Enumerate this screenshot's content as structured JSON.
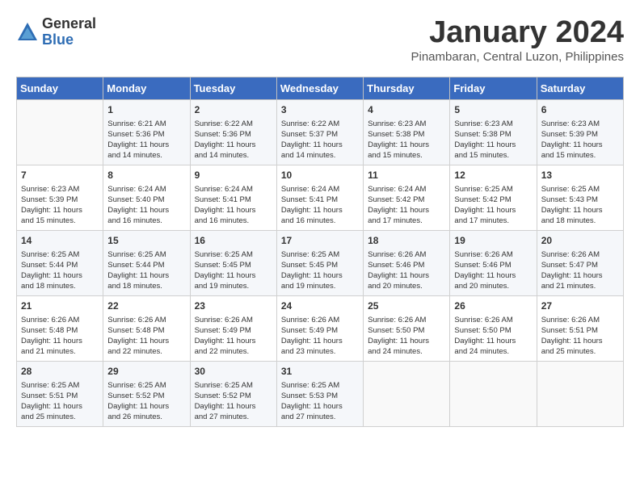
{
  "logo": {
    "general": "General",
    "blue": "Blue"
  },
  "header": {
    "month": "January 2024",
    "location": "Pinambaran, Central Luzon, Philippines"
  },
  "weekdays": [
    "Sunday",
    "Monday",
    "Tuesday",
    "Wednesday",
    "Thursday",
    "Friday",
    "Saturday"
  ],
  "weeks": [
    [
      {
        "day": "",
        "info": ""
      },
      {
        "day": "1",
        "info": "Sunrise: 6:21 AM\nSunset: 5:36 PM\nDaylight: 11 hours\nand 14 minutes."
      },
      {
        "day": "2",
        "info": "Sunrise: 6:22 AM\nSunset: 5:36 PM\nDaylight: 11 hours\nand 14 minutes."
      },
      {
        "day": "3",
        "info": "Sunrise: 6:22 AM\nSunset: 5:37 PM\nDaylight: 11 hours\nand 14 minutes."
      },
      {
        "day": "4",
        "info": "Sunrise: 6:23 AM\nSunset: 5:38 PM\nDaylight: 11 hours\nand 15 minutes."
      },
      {
        "day": "5",
        "info": "Sunrise: 6:23 AM\nSunset: 5:38 PM\nDaylight: 11 hours\nand 15 minutes."
      },
      {
        "day": "6",
        "info": "Sunrise: 6:23 AM\nSunset: 5:39 PM\nDaylight: 11 hours\nand 15 minutes."
      }
    ],
    [
      {
        "day": "7",
        "info": "Sunrise: 6:23 AM\nSunset: 5:39 PM\nDaylight: 11 hours\nand 15 minutes."
      },
      {
        "day": "8",
        "info": "Sunrise: 6:24 AM\nSunset: 5:40 PM\nDaylight: 11 hours\nand 16 minutes."
      },
      {
        "day": "9",
        "info": "Sunrise: 6:24 AM\nSunset: 5:41 PM\nDaylight: 11 hours\nand 16 minutes."
      },
      {
        "day": "10",
        "info": "Sunrise: 6:24 AM\nSunset: 5:41 PM\nDaylight: 11 hours\nand 16 minutes."
      },
      {
        "day": "11",
        "info": "Sunrise: 6:24 AM\nSunset: 5:42 PM\nDaylight: 11 hours\nand 17 minutes."
      },
      {
        "day": "12",
        "info": "Sunrise: 6:25 AM\nSunset: 5:42 PM\nDaylight: 11 hours\nand 17 minutes."
      },
      {
        "day": "13",
        "info": "Sunrise: 6:25 AM\nSunset: 5:43 PM\nDaylight: 11 hours\nand 18 minutes."
      }
    ],
    [
      {
        "day": "14",
        "info": "Sunrise: 6:25 AM\nSunset: 5:44 PM\nDaylight: 11 hours\nand 18 minutes."
      },
      {
        "day": "15",
        "info": "Sunrise: 6:25 AM\nSunset: 5:44 PM\nDaylight: 11 hours\nand 18 minutes."
      },
      {
        "day": "16",
        "info": "Sunrise: 6:25 AM\nSunset: 5:45 PM\nDaylight: 11 hours\nand 19 minutes."
      },
      {
        "day": "17",
        "info": "Sunrise: 6:25 AM\nSunset: 5:45 PM\nDaylight: 11 hours\nand 19 minutes."
      },
      {
        "day": "18",
        "info": "Sunrise: 6:26 AM\nSunset: 5:46 PM\nDaylight: 11 hours\nand 20 minutes."
      },
      {
        "day": "19",
        "info": "Sunrise: 6:26 AM\nSunset: 5:46 PM\nDaylight: 11 hours\nand 20 minutes."
      },
      {
        "day": "20",
        "info": "Sunrise: 6:26 AM\nSunset: 5:47 PM\nDaylight: 11 hours\nand 21 minutes."
      }
    ],
    [
      {
        "day": "21",
        "info": "Sunrise: 6:26 AM\nSunset: 5:48 PM\nDaylight: 11 hours\nand 21 minutes."
      },
      {
        "day": "22",
        "info": "Sunrise: 6:26 AM\nSunset: 5:48 PM\nDaylight: 11 hours\nand 22 minutes."
      },
      {
        "day": "23",
        "info": "Sunrise: 6:26 AM\nSunset: 5:49 PM\nDaylight: 11 hours\nand 22 minutes."
      },
      {
        "day": "24",
        "info": "Sunrise: 6:26 AM\nSunset: 5:49 PM\nDaylight: 11 hours\nand 23 minutes."
      },
      {
        "day": "25",
        "info": "Sunrise: 6:26 AM\nSunset: 5:50 PM\nDaylight: 11 hours\nand 24 minutes."
      },
      {
        "day": "26",
        "info": "Sunrise: 6:26 AM\nSunset: 5:50 PM\nDaylight: 11 hours\nand 24 minutes."
      },
      {
        "day": "27",
        "info": "Sunrise: 6:26 AM\nSunset: 5:51 PM\nDaylight: 11 hours\nand 25 minutes."
      }
    ],
    [
      {
        "day": "28",
        "info": "Sunrise: 6:25 AM\nSunset: 5:51 PM\nDaylight: 11 hours\nand 25 minutes."
      },
      {
        "day": "29",
        "info": "Sunrise: 6:25 AM\nSunset: 5:52 PM\nDaylight: 11 hours\nand 26 minutes."
      },
      {
        "day": "30",
        "info": "Sunrise: 6:25 AM\nSunset: 5:52 PM\nDaylight: 11 hours\nand 27 minutes."
      },
      {
        "day": "31",
        "info": "Sunrise: 6:25 AM\nSunset: 5:53 PM\nDaylight: 11 hours\nand 27 minutes."
      },
      {
        "day": "",
        "info": ""
      },
      {
        "day": "",
        "info": ""
      },
      {
        "day": "",
        "info": ""
      }
    ]
  ]
}
